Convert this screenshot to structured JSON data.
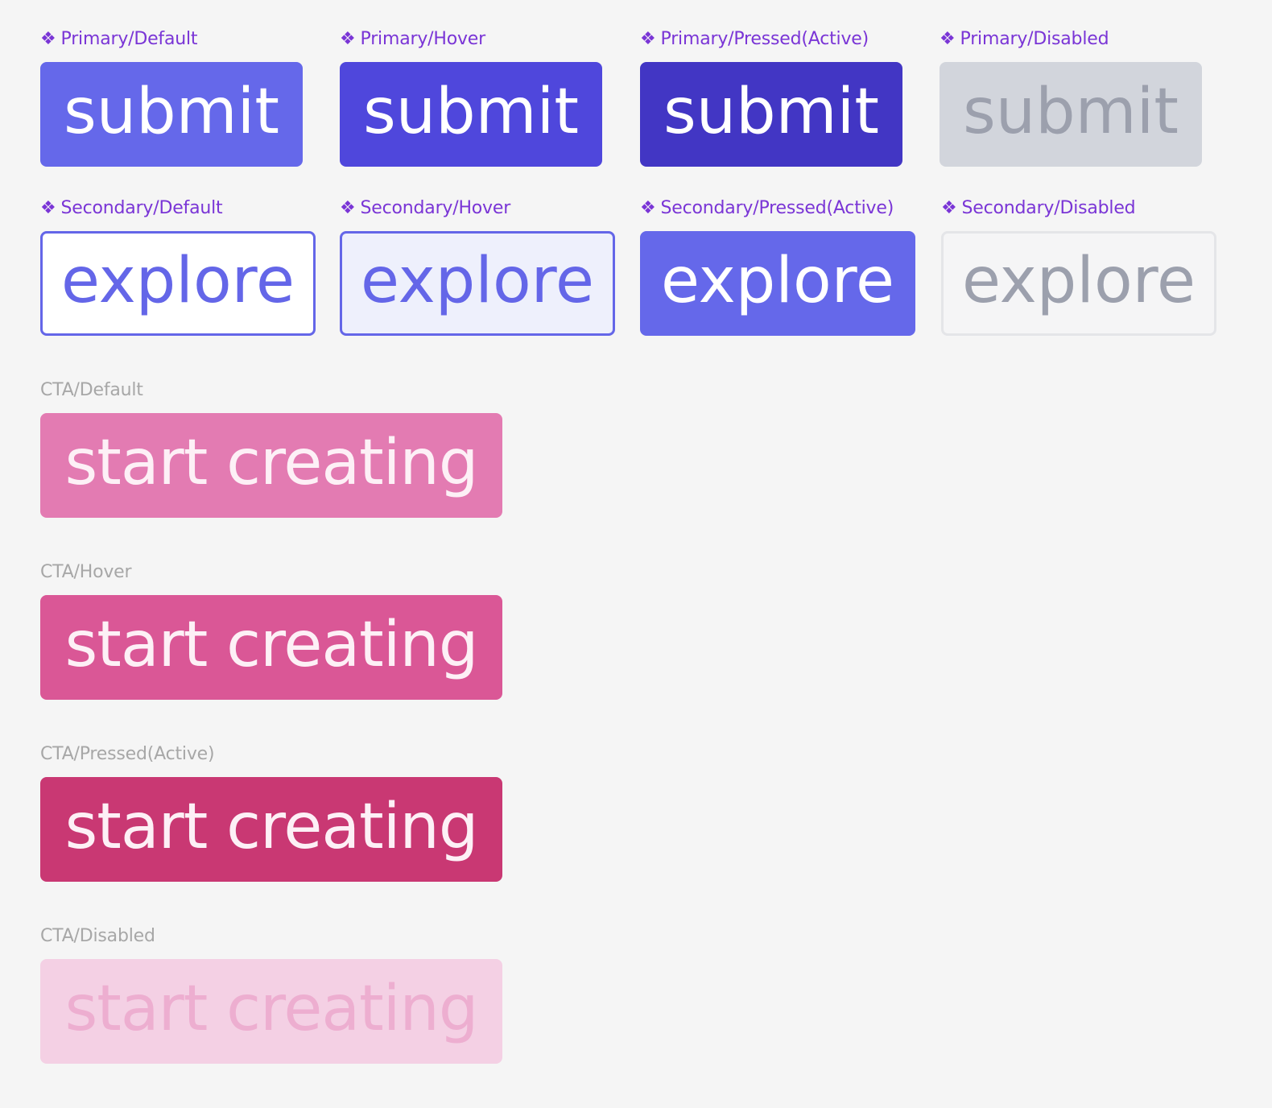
{
  "component_icon": "❖",
  "primary": {
    "label": "submit",
    "states": [
      {
        "name": "Primary/Default",
        "bg": "#6568ea",
        "fg": "#ffffff"
      },
      {
        "name": "Primary/Hover",
        "bg": "#4f47dc",
        "fg": "#ffffff"
      },
      {
        "name": "Primary/Pressed(Active)",
        "bg": "#4236c4",
        "fg": "#ffffff"
      },
      {
        "name": "Primary/Disabled",
        "bg": "#d2d5dc",
        "fg": "#9ca0ad"
      }
    ]
  },
  "secondary": {
    "label": "explore",
    "states": [
      {
        "name": "Secondary/Default",
        "bg": "#ffffff",
        "fg": "#6466e8",
        "border": "#6466e8"
      },
      {
        "name": "Secondary/Hover",
        "bg": "#eef0fc",
        "fg": "#6466e8",
        "border": "#6466e8"
      },
      {
        "name": "Secondary/Pressed(Active)",
        "bg": "#6568ea",
        "fg": "#ffffff",
        "border": "#6568ea"
      },
      {
        "name": "Secondary/Disabled",
        "bg": "#f5f5f6",
        "fg": "#9ca0ad",
        "border": "#e4e5e8"
      }
    ]
  },
  "cta": {
    "label": "start creating",
    "states": [
      {
        "name": "CTA/Default",
        "bg": "#e37bb2",
        "fg": "#fdf0f6"
      },
      {
        "name": "CTA/Hover",
        "bg": "#da5796",
        "fg": "#fdf0f6"
      },
      {
        "name": "CTA/Pressed(Active)",
        "bg": "#c93873",
        "fg": "#fdf0f6"
      },
      {
        "name": "CTA/Disabled",
        "bg": "#f4d0e4",
        "fg": "#edaed0"
      }
    ]
  }
}
